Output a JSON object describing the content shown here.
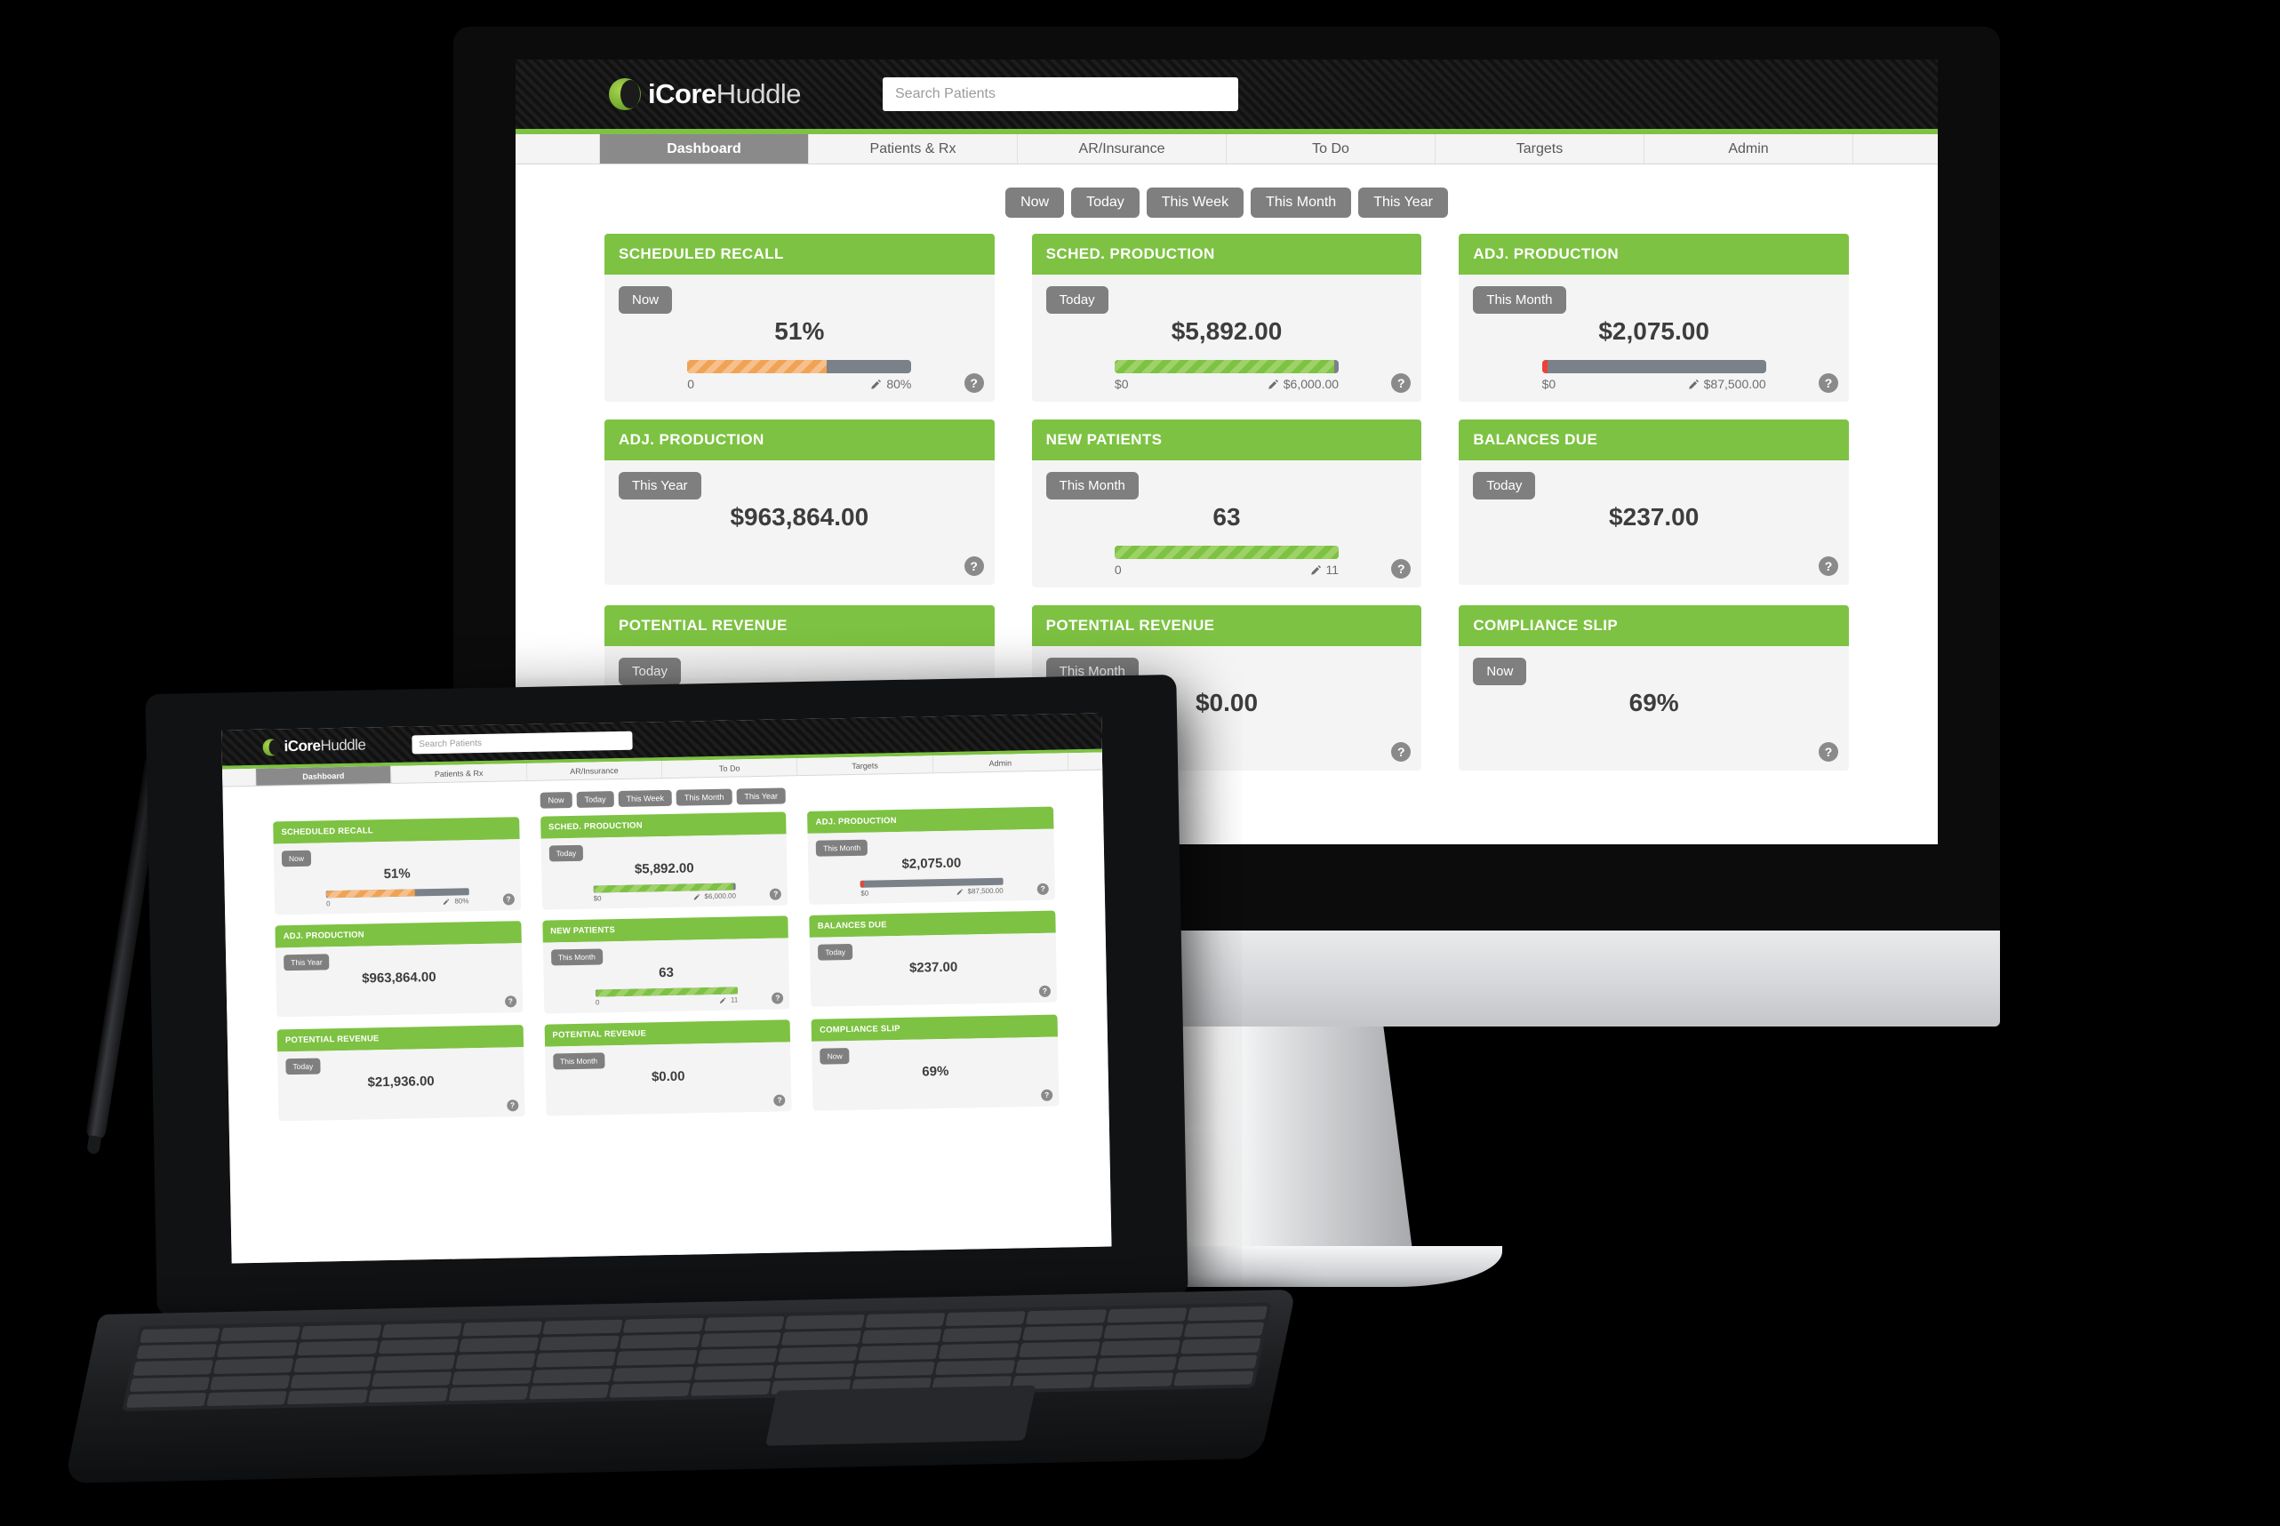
{
  "brand": {
    "name_bold": "iCore",
    "name_light": "Huddle",
    "logo_icon": "icorehuddle-ring-logo"
  },
  "search": {
    "placeholder": "Search Patients",
    "value": "",
    "icon": "search-icon"
  },
  "account": {
    "icon": "user-avatar-icon"
  },
  "tabs": [
    {
      "label": "Dashboard",
      "active": true
    },
    {
      "label": "Patients & Rx",
      "active": false
    },
    {
      "label": "AR/Insurance",
      "active": false
    },
    {
      "label": "To Do",
      "active": false
    },
    {
      "label": "Targets",
      "active": false
    },
    {
      "label": "Admin",
      "active": false
    }
  ],
  "filters": [
    {
      "label": "Now"
    },
    {
      "label": "Today"
    },
    {
      "label": "This Week"
    },
    {
      "label": "This Month"
    },
    {
      "label": "This Year"
    }
  ],
  "colors": {
    "brand_green": "#7dc242",
    "chip_gray": "#7f7f7f",
    "bar_track": "#7b8189",
    "bar_orange": "#f0a355",
    "bar_green": "#7dc242",
    "bar_red": "#ef4136",
    "card_bg": "#f4f4f4",
    "topbar": "#161616"
  },
  "help_label": "?",
  "pencil_icon": "pencil-edit-icon",
  "cards": [
    {
      "title": "SCHEDULED RECALL",
      "period": "Now",
      "value": "51%",
      "has_bar": true,
      "bar_percent": 62,
      "bar_style": "striped-orange",
      "min_label": "0",
      "max_label": "80%"
    },
    {
      "title": "SCHED. PRODUCTION",
      "period": "Today",
      "value": "$5,892.00",
      "has_bar": true,
      "bar_percent": 98,
      "bar_style": "striped-green",
      "min_label": "$0",
      "max_label": "$6,000.00"
    },
    {
      "title": "ADJ. PRODUCTION",
      "period": "This Month",
      "value": "$2,075.00",
      "has_bar": true,
      "bar_percent": 2.4,
      "bar_style": "solid-red",
      "min_label": "$0",
      "max_label": "$87,500.00"
    },
    {
      "title": "ADJ. PRODUCTION",
      "period": "This Year",
      "value": "$963,864.00",
      "has_bar": false,
      "bar_percent": 0,
      "bar_style": "",
      "min_label": "",
      "max_label": ""
    },
    {
      "title": "NEW PATIENTS",
      "period": "This Month",
      "value": "63",
      "has_bar": true,
      "bar_percent": 100,
      "bar_style": "striped-green",
      "min_label": "0",
      "max_label": "11"
    },
    {
      "title": "BALANCES DUE",
      "period": "Today",
      "value": "$237.00",
      "has_bar": false,
      "bar_percent": 0,
      "bar_style": "",
      "min_label": "",
      "max_label": ""
    },
    {
      "title": "POTENTIAL REVENUE",
      "period": "Today",
      "value": "$21,936.00",
      "has_bar": false,
      "bar_percent": 0,
      "bar_style": "",
      "min_label": "",
      "max_label": ""
    },
    {
      "title": "POTENTIAL REVENUE",
      "period": "This Month",
      "value": "$0.00",
      "has_bar": false,
      "bar_percent": 0,
      "bar_style": "",
      "min_label": "",
      "max_label": ""
    },
    {
      "title": "COMPLIANCE SLIP",
      "period": "Now",
      "value": "69%",
      "has_bar": false,
      "bar_percent": 0,
      "bar_style": "",
      "min_label": "",
      "max_label": ""
    }
  ]
}
